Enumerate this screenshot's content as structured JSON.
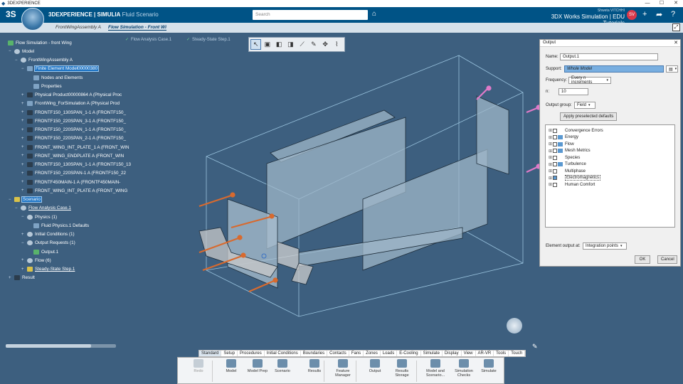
{
  "app": {
    "window_title": "3DEXPERIENCE",
    "brand_bold": "3DEXPERIENCE | SIMULIA",
    "brand_sub": "Fluid Scenario",
    "search_placeholder": "Search",
    "user": "Shweta VITCHHI",
    "context": "3DX Works Simulation | EDU Tutorials",
    "avatar_initials": "SV"
  },
  "tabs": [
    {
      "label": "FrontWingAssembly A",
      "active": false
    },
    {
      "label": "Flow Simulation - Front Wi",
      "active": true
    }
  ],
  "breadcrumbs": [
    {
      "label": "Flow Analysis Case.1"
    },
    {
      "label": "Steady-State Step.1"
    }
  ],
  "tree": [
    {
      "label": "Flow Simulation - front Wing",
      "indent": 0,
      "exp": "",
      "icon": "green"
    },
    {
      "label": "Model",
      "indent": 1,
      "exp": "−",
      "icon": "gear"
    },
    {
      "label": "FrontWingAssembly A",
      "indent": 2,
      "exp": "−",
      "icon": "gear"
    },
    {
      "label": "Finite Element Model00000380",
      "indent": 3,
      "exp": "−",
      "icon": "plain",
      "sel": true
    },
    {
      "label": "Nodes and Elements",
      "indent": 4,
      "exp": "",
      "icon": "plain"
    },
    {
      "label": "Properties",
      "indent": 4,
      "exp": "",
      "icon": "plain"
    },
    {
      "label": "Physical Product00000864 A (Physical Proc",
      "indent": 3,
      "exp": "+",
      "icon": "dark"
    },
    {
      "label": "FrontWing_ForSimulation A (Physical Prod",
      "indent": 3,
      "exp": "+",
      "icon": "plain"
    },
    {
      "label": "FRONTF150_130SPAN_1-1 A (FRONTF150_",
      "indent": 3,
      "exp": "+",
      "icon": "dark"
    },
    {
      "label": "FRONTF150_220SPAN_3-1 A (FRONTF150_",
      "indent": 3,
      "exp": "+",
      "icon": "dark"
    },
    {
      "label": "FRONTF150_220SPAN_1-1 A (FRONTF150_",
      "indent": 3,
      "exp": "+",
      "icon": "dark"
    },
    {
      "label": "FRONTF150_220SPAN_2-1 A (FRONTF150_",
      "indent": 3,
      "exp": "+",
      "icon": "dark"
    },
    {
      "label": "FRONT_WING_INT_PLATE_1 A (FRONT_WIN",
      "indent": 3,
      "exp": "+",
      "icon": "dark"
    },
    {
      "label": "FRONT_WING_ENDPLATE A (FRONT_WIN",
      "indent": 3,
      "exp": "+",
      "icon": "dark"
    },
    {
      "label": "FRONTF150_130SPAN_1-1 A (FRONTF150_13",
      "indent": 3,
      "exp": "+",
      "icon": "dark"
    },
    {
      "label": "FRONTF150_220SPAN-1 A (FRONTF150_22",
      "indent": 3,
      "exp": "+",
      "icon": "dark"
    },
    {
      "label": "FRONTF450MAIN-1 A (FRONTF450MAIN-",
      "indent": 3,
      "exp": "+",
      "icon": "dark"
    },
    {
      "label": "FRONT_WING_INT_PLATE A (FRONT_WING",
      "indent": 3,
      "exp": "+",
      "icon": "dark"
    },
    {
      "label": "Scenario",
      "indent": 1,
      "exp": "−",
      "icon": "yellow",
      "sel": true
    },
    {
      "label": "Flow Analysis Case.1",
      "indent": 2,
      "exp": "−",
      "icon": "gear",
      "ul": true
    },
    {
      "label": "Physics (1)",
      "indent": 3,
      "exp": "−",
      "icon": "gear"
    },
    {
      "label": "Fluid Physics.1 Defaults",
      "indent": 4,
      "exp": "",
      "icon": "plain"
    },
    {
      "label": "Initial Conditions (1)",
      "indent": 3,
      "exp": "+",
      "icon": "gear"
    },
    {
      "label": "Output Requests (1)",
      "indent": 3,
      "exp": "−",
      "icon": "gear"
    },
    {
      "label": "Output.1",
      "indent": 4,
      "exp": "",
      "icon": "green"
    },
    {
      "label": "Flow (6)",
      "indent": 3,
      "exp": "+",
      "icon": "gear"
    },
    {
      "label": "Steady-State Step.1",
      "indent": 3,
      "exp": "+",
      "icon": "yellow",
      "ul": true
    },
    {
      "label": "Result",
      "indent": 1,
      "exp": "+",
      "icon": "dark"
    }
  ],
  "output_panel": {
    "title": "Output",
    "name_label": "Name:",
    "name_value": "Output.1",
    "support_label": "Support:",
    "support_value": "Whole Model",
    "frequency_label": "Frequency:",
    "frequency_value": "Every n increments",
    "n_label": "n:",
    "n_value": "10",
    "output_group_label": "Output group:",
    "output_group_value": "Field",
    "apply_label": "Apply preselected defaults",
    "items": [
      {
        "label": "Convergence Errors",
        "icon": "none",
        "checked": false
      },
      {
        "label": "Energy",
        "icon": "blue",
        "checked": false
      },
      {
        "label": "Flow",
        "icon": "blue",
        "checked": false
      },
      {
        "label": "Mesh Metrics",
        "icon": "blue",
        "checked": false
      },
      {
        "label": "Species",
        "icon": "none",
        "checked": false
      },
      {
        "label": "Turbulence",
        "icon": "blue",
        "checked": false
      },
      {
        "label": "Multiphase",
        "icon": "none",
        "checked": false
      },
      {
        "label": "Electromagnetics",
        "icon": "none",
        "checked": true,
        "hl": true
      },
      {
        "label": "Human Comfort",
        "icon": "none",
        "checked": false
      }
    ],
    "element_output_label": "Element output at:",
    "element_output_value": "Integration points",
    "ok_label": "OK",
    "cancel_label": "Cancel"
  },
  "ribbon_tabs": [
    {
      "label": "Standard",
      "active": true
    },
    {
      "label": "Setup"
    },
    {
      "label": "Procedures"
    },
    {
      "label": "Initial Conditions"
    },
    {
      "label": "Boundaries"
    },
    {
      "label": "Contacts"
    },
    {
      "label": "Fans"
    },
    {
      "label": "Zones"
    },
    {
      "label": "Loads"
    },
    {
      "label": "E-Cooling"
    },
    {
      "label": "Simulate"
    },
    {
      "label": "Display"
    },
    {
      "label": "View"
    },
    {
      "label": "AR-VR"
    },
    {
      "label": "Tools"
    },
    {
      "label": "Touch"
    }
  ],
  "ribbon": [
    {
      "label": "Redo",
      "disabled": true
    },
    {
      "label": "Model"
    },
    {
      "label": "Model Prep"
    },
    {
      "label": "Scenario"
    },
    {
      "label": "Results"
    },
    {
      "label": "Feature Manager"
    },
    {
      "label": "Output"
    },
    {
      "label": "Results Storage"
    },
    {
      "label": "Model and Scenario..."
    },
    {
      "label": "Simulation Checks"
    },
    {
      "label": "Simulate"
    }
  ]
}
